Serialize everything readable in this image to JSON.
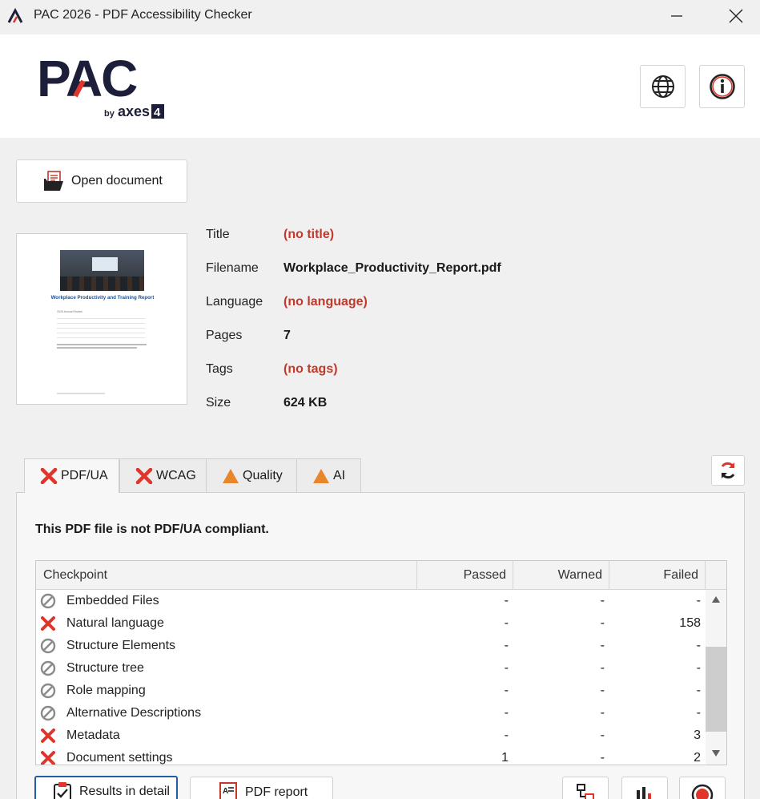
{
  "window": {
    "title": "PAC 2026 - PDF Accessibility Checker"
  },
  "logo": {
    "main": "PAC",
    "byline": "by axes4"
  },
  "toolbar": {
    "open_label": "Open document"
  },
  "thumbnail": {
    "doc_title": "Workplace Productivity and Training Report",
    "doc_subtitle": "2026 Annual Review"
  },
  "metadata": [
    {
      "label": "Title",
      "value": "(no title)",
      "missing": true
    },
    {
      "label": "Filename",
      "value": "Workplace_Productivity_Report.pdf",
      "missing": false
    },
    {
      "label": "Language",
      "value": "(no language)",
      "missing": true
    },
    {
      "label": "Pages",
      "value": "7",
      "missing": false
    },
    {
      "label": "Tags",
      "value": "(no tags)",
      "missing": true
    },
    {
      "label": "Size",
      "value": "624 KB",
      "missing": false
    }
  ],
  "tabs": [
    {
      "label": "PDF/UA",
      "icon": "fail-x-icon",
      "active": true
    },
    {
      "label": "WCAG",
      "icon": "fail-x-icon",
      "active": false
    },
    {
      "label": "Quality",
      "icon": "warning-triangle-icon",
      "active": false
    },
    {
      "label": "AI",
      "icon": "warning-triangle-icon",
      "active": false
    }
  ],
  "panel": {
    "status": "This PDF file is not PDF/UA compliant."
  },
  "table": {
    "headers": {
      "checkpoint": "Checkpoint",
      "passed": "Passed",
      "warned": "Warned",
      "failed": "Failed"
    },
    "rows": [
      {
        "name": "Embedded Files",
        "status": "skipped",
        "passed": "-",
        "warned": "-",
        "failed": "-"
      },
      {
        "name": "Natural language",
        "status": "failed",
        "passed": "-",
        "warned": "-",
        "failed": "158"
      },
      {
        "name": "Structure Elements",
        "status": "skipped",
        "passed": "-",
        "warned": "-",
        "failed": "-"
      },
      {
        "name": "Structure tree",
        "status": "skipped",
        "passed": "-",
        "warned": "-",
        "failed": "-"
      },
      {
        "name": "Role mapping",
        "status": "skipped",
        "passed": "-",
        "warned": "-",
        "failed": "-"
      },
      {
        "name": "Alternative Descriptions",
        "status": "skipped",
        "passed": "-",
        "warned": "-",
        "failed": "-"
      },
      {
        "name": "Metadata",
        "status": "failed",
        "passed": "-",
        "warned": "-",
        "failed": "3"
      },
      {
        "name": "Document settings",
        "status": "failed",
        "passed": "1",
        "warned": "-",
        "failed": "2"
      }
    ]
  },
  "bottom": {
    "results_label": "Results in detail",
    "report_label": "PDF report"
  },
  "colors": {
    "fail": "#e0352b",
    "warning": "#e8862a",
    "missing_value": "#c0392b",
    "focus": "#1f5fa8"
  }
}
